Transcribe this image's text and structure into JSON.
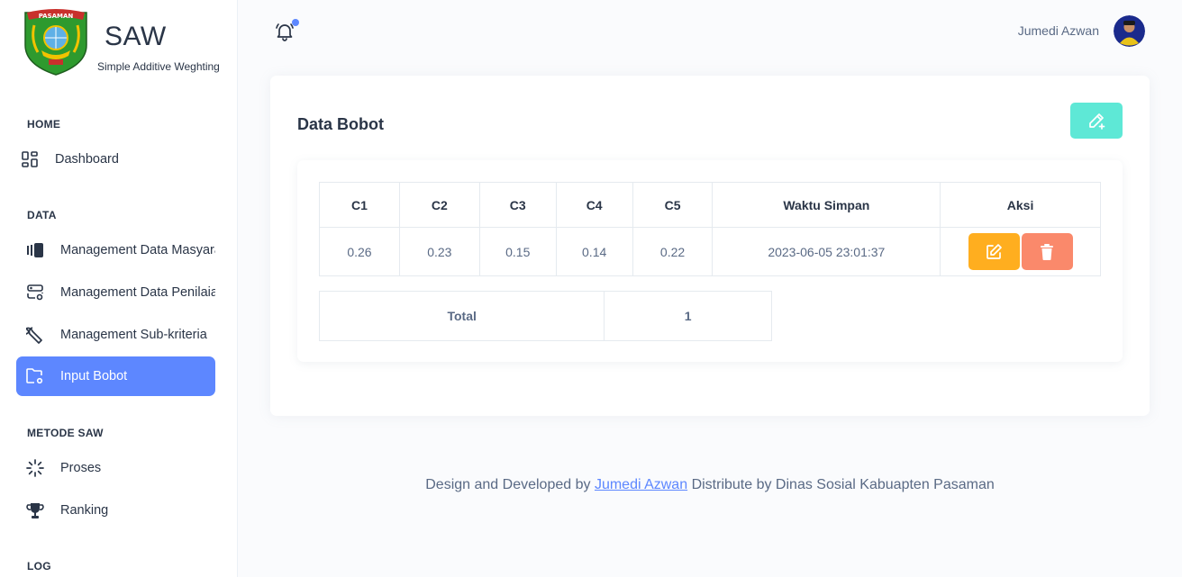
{
  "brand": {
    "title": "SAW",
    "subtitle": "Simple Additive Weghting",
    "logo_text": "PASAMAN"
  },
  "nav": {
    "home_caption": "HOME",
    "dashboard": "Dashboard",
    "data_caption": "DATA",
    "masyarakat": "Management Data Masyarakat",
    "penilaian": "Management Data Penilaian",
    "subkriteria": "Management Sub-kriteria",
    "input_bobot": "Input Bobot",
    "metode_caption": "METODE SAW",
    "proses": "Proses",
    "ranking": "Ranking",
    "log_caption": "LOG"
  },
  "header": {
    "user_name": "Jumedi Azwan",
    "notification_dot": true
  },
  "card": {
    "title": "Data Bobot"
  },
  "table": {
    "headers": [
      "C1",
      "C2",
      "C3",
      "C4",
      "C5",
      "Waktu Simpan",
      "Aksi"
    ],
    "rows": [
      {
        "c1": "0.26",
        "c2": "0.23",
        "c3": "0.15",
        "c4": "0.14",
        "c5": "0.22",
        "waktu": "2023-06-05 23:01:37"
      }
    ]
  },
  "total": {
    "label": "Total",
    "value": "1"
  },
  "footer": {
    "prefix": "Design and Developed by",
    "author": "Jumedi Azwan",
    "suffix": "Distribute by Dinas Sosial Kabuapten Pasaman"
  },
  "colors": {
    "primary": "#5d87ff",
    "add_button": "#5ee8d6",
    "edit_button": "#ffae1f",
    "delete_button": "#fa896b"
  }
}
